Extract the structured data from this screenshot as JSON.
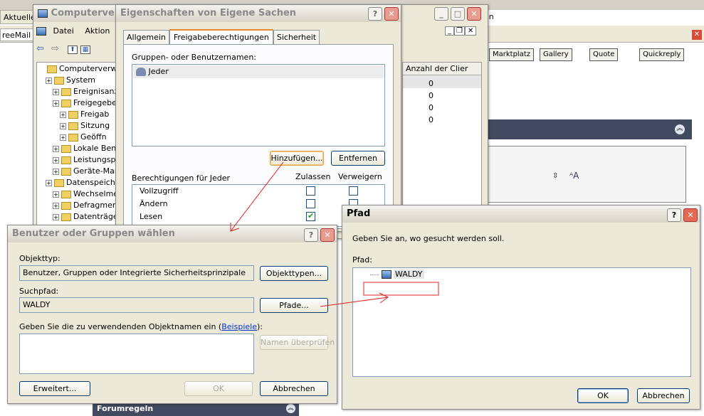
{
  "browser": {
    "tab1": "Aktuelle N",
    "tab2": "reeMail vo",
    "behind_tab": "en",
    "forum_buttons": [
      "Marktplatz",
      "Gallery",
      "Quote",
      "Quickreply"
    ],
    "forumregeln": "Forumregeln"
  },
  "compmgmt": {
    "title": "Computerverw",
    "menu": [
      "Datei",
      "Aktion"
    ],
    "tree": [
      {
        "label": "Computerverwaltun",
        "indent": 0
      },
      {
        "label": "System",
        "indent": 1
      },
      {
        "label": "Ereignisanz",
        "indent": 2
      },
      {
        "label": "Freigegebe",
        "indent": 2
      },
      {
        "label": "Freigab",
        "indent": 3
      },
      {
        "label": "Sitzung",
        "indent": 3
      },
      {
        "label": "Geöffn",
        "indent": 3
      },
      {
        "label": "Lokale Benu",
        "indent": 2
      },
      {
        "label": "Leistungspr",
        "indent": 2
      },
      {
        "label": "Geräte-Mar",
        "indent": 2
      },
      {
        "label": "Datenspeicher",
        "indent": 1
      },
      {
        "label": "Wechselme",
        "indent": 2
      },
      {
        "label": "Defragmen",
        "indent": 2
      },
      {
        "label": "Datenträge",
        "indent": 2
      }
    ],
    "col_header": "Anzahl der Clier",
    "col_values": [
      "0",
      "0",
      "0",
      "0"
    ]
  },
  "props": {
    "title": "Eigenschaften von Eigene Sachen",
    "tabs": [
      "Allgemein",
      "Freigabeberechtigungen",
      "Sicherheit"
    ],
    "groups_label": "Gruppen- oder Benutzernamen:",
    "group_item": "Jeder",
    "add_button": "Hinzufügen...",
    "remove_button": "Entfernen",
    "perm_label": "Berechtigungen für Jeder",
    "allow_header": "Zulassen",
    "deny_header": "Verweigern",
    "permissions": [
      {
        "name": "Vollzugriff",
        "allow": false,
        "deny": false
      },
      {
        "name": "Ändern",
        "allow": false,
        "deny": false
      },
      {
        "name": "Lesen",
        "allow": true,
        "deny": false
      }
    ]
  },
  "select_dialog": {
    "title": "Benutzer oder Gruppen wählen",
    "objtype_label": "Objekttyp:",
    "objtype_value": "Benutzer, Gruppen oder Integrierte Sicherheitsprinzipale",
    "objtype_button": "Objekttypen...",
    "path_label": "Suchpfad:",
    "path_value": "WALDY",
    "path_button": "Pfade...",
    "names_label": "Geben Sie die zu verwendenden Objektnamen ein (",
    "names_link": "Beispiele",
    "names_label_end": "):",
    "check_button": "Namen überprüfen",
    "advanced_button": "Erweitert...",
    "ok_button": "OK",
    "cancel_button": "Abbrechen"
  },
  "pfad_dialog": {
    "title": "Pfad",
    "prompt": "Geben Sie an, wo gesucht werden soll.",
    "path_label": "Pfad:",
    "tree_item": "WALDY",
    "ok_button": "OK",
    "cancel_button": "Abbrechen"
  },
  "colors": {
    "annotation": "#e02020",
    "accent": "#0a246a"
  }
}
